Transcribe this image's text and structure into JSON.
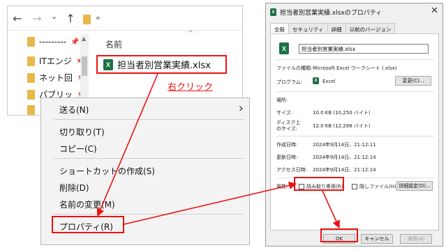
{
  "explorer": {
    "nav": {
      "back": "←",
      "forward": "→",
      "dropdown": "⌄",
      "up": "↑",
      "address_sep": "«"
    },
    "quick_access": [
      {
        "label": "---------",
        "pin": "📌"
      },
      {
        "label": "ITエンジ",
        "pin": "📌"
      },
      {
        "label": "ネット回",
        "pin": "📌"
      },
      {
        "label": "パブリッ",
        "pin": "📌"
      },
      {
        "label": "",
        "pin": ""
      }
    ],
    "column_header": "名前",
    "file": {
      "icon": "X",
      "name": "担当者別営業実績.xlsx"
    }
  },
  "annotation": {
    "right_click": "右クリック"
  },
  "context_menu": {
    "items": [
      {
        "label": "送る(N)"
      },
      {
        "label": "切り取り(T)"
      },
      {
        "label": "コピー(C)"
      },
      {
        "label": "ショートカットの作成(S)"
      },
      {
        "label": "削除(D)"
      },
      {
        "label": "名前の変更(M)"
      },
      {
        "label": "プロパティ(R)"
      }
    ],
    "submenu_chevron": "›"
  },
  "dialog": {
    "title": "担当者別営業実績.xlsxのプロパティ",
    "close": "✕",
    "tabs": [
      "全般",
      "セキュリティ",
      "詳細",
      "以前のバージョン"
    ],
    "file_name": "担当者別営業実績.xlsx",
    "rows": {
      "file_type_label": "ファイルの種類:",
      "file_type_value": "Microsoft Excel ワークシート (.xlsx)",
      "program_label": "プログラム:",
      "program_value": "Excel",
      "change_button": "変更(C)...",
      "location_label": "場所:",
      "size_label": "サイズ:",
      "size_value": "10.0 KB (10,250 バイト)",
      "disk_size_label_1": "ディスク上",
      "disk_size_label_2": "のサイズ:",
      "disk_size_value": "12.0 KB (12,288 バイト)",
      "created_label": "作成日時:",
      "created_value": "2024年9月14日、21:12:11",
      "modified_label": "更新日時:",
      "modified_value": "2024年9月14日、21:12:14",
      "accessed_label": "アクセス日時:",
      "accessed_value": "2024年9月14日、21:12:14",
      "attributes_label": "属性:",
      "readonly_label": "読み取り専用(R)",
      "hidden_label": "隠しファイル(H)",
      "advanced_button": "詳細設定(D)..."
    },
    "buttons": {
      "ok": "OK",
      "cancel": "キャンセル",
      "apply": "適用(A)"
    }
  },
  "colors": {
    "highlight": "#ee1111",
    "excel": "#1d7044",
    "folder": "#e8b84a"
  }
}
